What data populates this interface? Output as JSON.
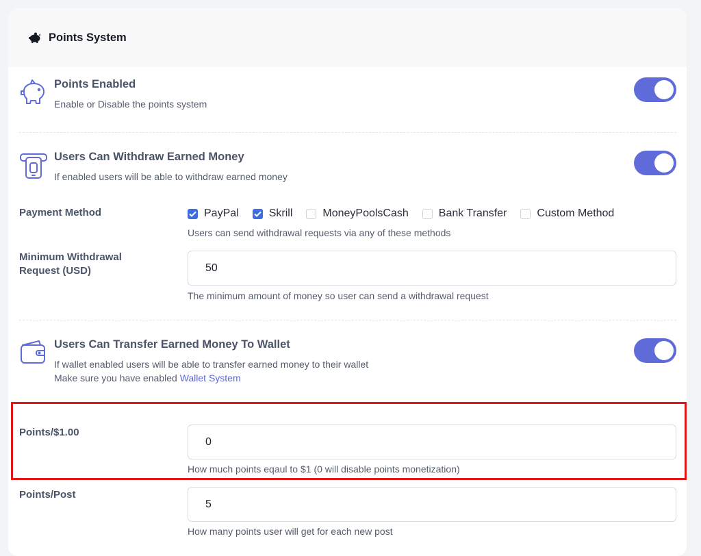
{
  "header": {
    "title": "Points System",
    "icon": "piggy-bank-icon"
  },
  "points_enabled": {
    "title": "Points Enabled",
    "description": "Enable or Disable the points system",
    "icon": "piggy-bank-icon",
    "enabled": true
  },
  "withdraw": {
    "title": "Users Can Withdraw Earned Money",
    "description": "If enabled users will be able to withdraw earned money",
    "icon": "cash-icon",
    "enabled": true
  },
  "payment_method": {
    "label": "Payment Method",
    "options": [
      {
        "label": "PayPal",
        "checked": true
      },
      {
        "label": "Skrill",
        "checked": true
      },
      {
        "label": "MoneyPoolsCash",
        "checked": false
      },
      {
        "label": "Bank Transfer",
        "checked": false
      },
      {
        "label": "Custom Method",
        "checked": false
      }
    ],
    "help": "Users can send withdrawal requests via any of these methods"
  },
  "min_withdrawal": {
    "label_line1": "Minimum Withdrawal",
    "label_line2": "Request (USD)",
    "value": "50",
    "help": "The minimum amount of money so user can send a withdrawal request"
  },
  "transfer_wallet": {
    "title": "Users Can Transfer Earned Money To Wallet",
    "description_line1": "If wallet enabled users will be able to transfer earned money to their wallet",
    "description_line2_prefix": "Make sure you have enabled ",
    "description_link": "Wallet System",
    "icon": "wallet-icon",
    "enabled": true
  },
  "points_per_dollar": {
    "label": "Points/$1.00",
    "value": "0",
    "help": "How much points eqaul to $1 (0 will disable points monetization)"
  },
  "points_per_post": {
    "label": "Points/Post",
    "value": "5",
    "help": "How many points user will get for each new post"
  },
  "colors": {
    "toggle_on": "#5e6bd8",
    "checkbox_on": "#3b6fe0",
    "highlight": "#e01818",
    "link": "#5e69d9"
  }
}
